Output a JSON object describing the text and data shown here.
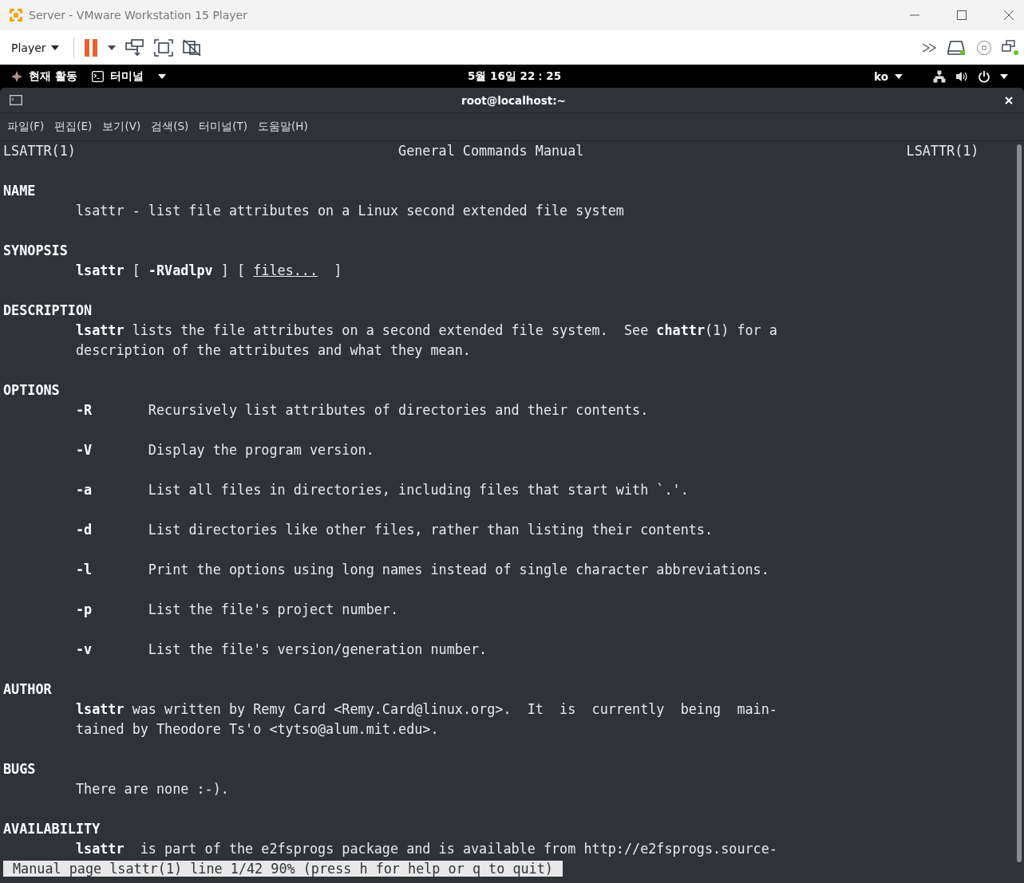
{
  "window": {
    "title": "Server - VMware Workstation 15 Player"
  },
  "toolbar": {
    "player_menu": "Player"
  },
  "top_bar": {
    "activities": "현재 활동",
    "app_menu": "터미널",
    "clock": "5월 16일 22：25",
    "input_method": "ko"
  },
  "terminal": {
    "title": "root@localhost:~",
    "menu": [
      "파일(F)",
      "편집(E)",
      "보기(V)",
      "검색(S)",
      "터미널(T)",
      "도움말(H)"
    ],
    "lines": [
      {
        "kind": "title",
        "left": "LSATTR(1)",
        "center": "General Commands Manual",
        "right": "LSATTR(1)"
      },
      {
        "kind": "blank"
      },
      {
        "kind": "heading",
        "text": "NAME"
      },
      {
        "kind": "body",
        "text": "lsattr - list file attributes on a Linux second extended file system"
      },
      {
        "kind": "blank"
      },
      {
        "kind": "heading",
        "text": "SYNOPSIS"
      },
      {
        "kind": "synopsis",
        "text": "**lsattr** [ **-RVadlpv** ] [ ",
        "argument": "files...",
        "tail": "  ]"
      },
      {
        "kind": "blank"
      },
      {
        "kind": "heading",
        "text": "DESCRIPTION"
      },
      {
        "kind": "body",
        "text": "**lsattr** lists the file attributes on a second extended file system.  See **chattr**(1) for a"
      },
      {
        "kind": "body",
        "text": "description of the attributes and what they mean."
      },
      {
        "kind": "blank"
      },
      {
        "kind": "heading",
        "text": "OPTIONS"
      },
      {
        "kind": "option",
        "flag": "-R",
        "text": "Recursively list attributes of directories and their contents."
      },
      {
        "kind": "blank"
      },
      {
        "kind": "option",
        "flag": "-V",
        "text": "Display the program version."
      },
      {
        "kind": "blank"
      },
      {
        "kind": "option",
        "flag": "-a",
        "text": "List all files in directories, including files that start with `.'."
      },
      {
        "kind": "blank"
      },
      {
        "kind": "option",
        "flag": "-d",
        "text": "List directories like other files, rather than listing their contents."
      },
      {
        "kind": "blank"
      },
      {
        "kind": "option",
        "flag": "-l",
        "text": "Print the options using long names instead of single character abbreviations."
      },
      {
        "kind": "blank"
      },
      {
        "kind": "option",
        "flag": "-p",
        "text": "List the file's project number."
      },
      {
        "kind": "blank"
      },
      {
        "kind": "option",
        "flag": "-v",
        "text": "List the file's version/generation number."
      },
      {
        "kind": "blank"
      },
      {
        "kind": "heading",
        "text": "AUTHOR"
      },
      {
        "kind": "body",
        "text": "**lsattr** was written by Remy Card <Remy.Card@linux.org>.  It  is  currently  being  main‐"
      },
      {
        "kind": "body",
        "text": "tained by Theodore Ts'o <tytso@alum.mit.edu>."
      },
      {
        "kind": "blank"
      },
      {
        "kind": "heading",
        "text": "BUGS"
      },
      {
        "kind": "body",
        "text": "There are none :-)."
      },
      {
        "kind": "blank"
      },
      {
        "kind": "heading",
        "text": "AVAILABILITY"
      },
      {
        "kind": "body",
        "text": "**lsattr**  is part of the e2fsprogs package and is available from http://e2fsprogs.source‐"
      }
    ],
    "status": "Manual page lsattr(1) line 1/42 90% (press h for help or q to quit)"
  }
}
